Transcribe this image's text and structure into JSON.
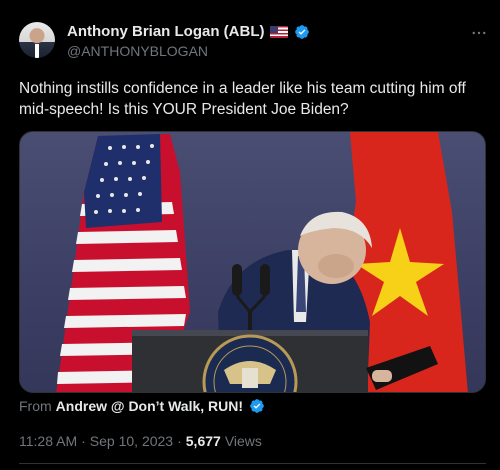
{
  "author": {
    "display_name": "Anthony Brian Logan (ABL)",
    "handle": "@ANTHONYBLOGAN",
    "flag_icon": "us-flag-emoji",
    "verified_icon": "verified-badge-icon"
  },
  "tweet": {
    "text": "Nothing instills confidence in a leader like his team cutting him off mid-speech! Is this YOUR President Joe Biden?"
  },
  "media": {
    "kind": "video-still",
    "from_label": "From",
    "from_account": "Andrew @ Don’t Walk, RUN!"
  },
  "meta": {
    "time": "11:28 AM",
    "separator1": "·",
    "date": "Sep 10, 2023",
    "separator2": "·",
    "views_count": "5,677",
    "views_label": "Views"
  },
  "colors": {
    "accent": "#1d9bf0",
    "text_primary": "#e7e9ea",
    "text_secondary": "#71767b",
    "background": "#000000"
  }
}
